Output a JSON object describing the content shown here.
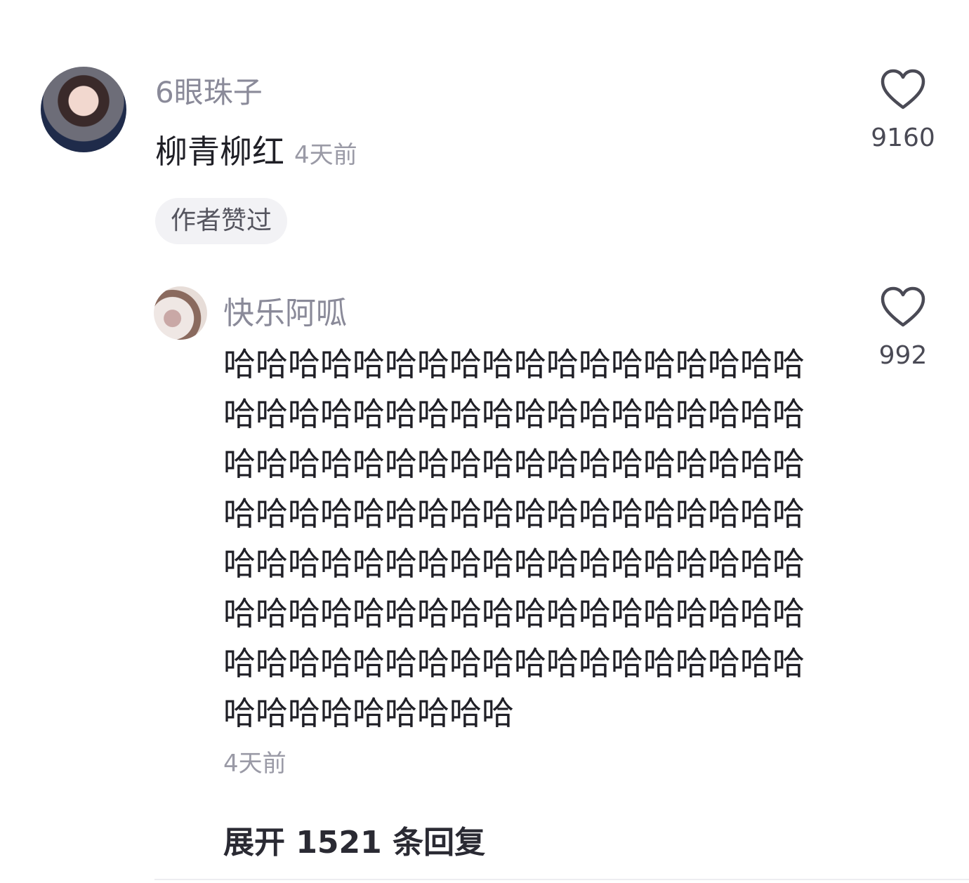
{
  "comment": {
    "username": "6眼珠子",
    "text": "柳青柳红",
    "time": "4天前",
    "badge": "作者赞过",
    "like_count": "9160",
    "icons": {
      "like": "heart-outline-icon"
    }
  },
  "reply": {
    "username": "快乐阿呱",
    "text": "哈哈哈哈哈哈哈哈哈哈哈哈哈哈哈哈哈哈哈哈哈哈哈哈哈哈哈哈哈哈哈哈哈哈哈哈哈哈哈哈哈哈哈哈哈哈哈哈哈哈哈哈哈哈哈哈哈哈哈哈哈哈哈哈哈哈哈哈哈哈哈哈哈哈哈哈哈哈哈哈哈哈哈哈哈哈哈哈哈哈哈哈哈哈哈哈哈哈哈哈哈哈哈哈哈哈哈哈哈哈哈哈哈哈哈哈哈哈哈哈哈哈哈哈哈哈哈哈哈哈哈哈哈哈哈",
    "time": "4天前",
    "like_count": "992",
    "icons": {
      "like": "heart-outline-icon"
    }
  },
  "expand": {
    "label": "展开 1521 条回复"
  },
  "colors": {
    "username": "#8a8a99",
    "body_text": "#1f1f26",
    "meta_text": "#9a9aa6",
    "badge_bg": "#f2f2f5"
  }
}
